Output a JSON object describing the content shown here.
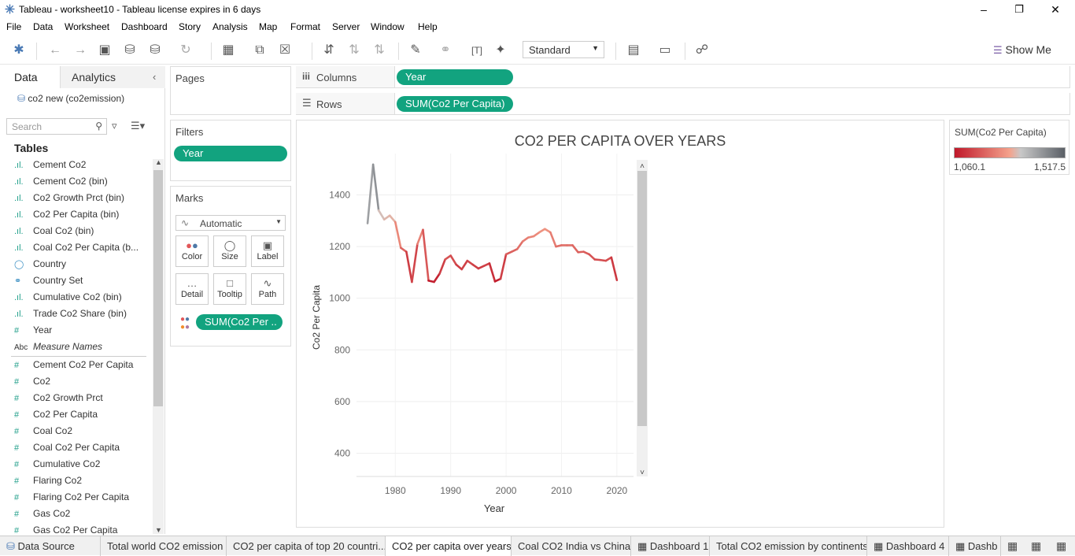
{
  "window": {
    "title": "Tableau - worksheet10 - Tableau license expires in 6 days"
  },
  "menu": [
    "File",
    "Data",
    "Worksheet",
    "Dashboard",
    "Story",
    "Analysis",
    "Map",
    "Format",
    "Server",
    "Window",
    "Help"
  ],
  "toolbar": {
    "fit_select": "Standard",
    "show_me": "Show Me"
  },
  "data_pane": {
    "tab_data": "Data",
    "tab_analytics": "Analytics",
    "datasource": "co2 new (co2emission)",
    "search_placeholder": "Search",
    "tables_title": "Tables",
    "dimensions": [
      {
        "icon": "bin-icon",
        "label": "Cement Co2"
      },
      {
        "icon": "bin-icon",
        "label": "Cement Co2 (bin)"
      },
      {
        "icon": "bin-icon",
        "label": "Co2 Growth Prct (bin)"
      },
      {
        "icon": "bin-icon",
        "label": "Co2 Per Capita (bin)"
      },
      {
        "icon": "bin-icon",
        "label": "Coal Co2 (bin)"
      },
      {
        "icon": "bin-icon",
        "label": "Coal Co2 Per Capita (b..."
      },
      {
        "icon": "globe-icon",
        "label": "Country"
      },
      {
        "icon": "set-icon",
        "label": "Country Set"
      },
      {
        "icon": "bin-icon",
        "label": "Cumulative Co2 (bin)"
      },
      {
        "icon": "bin-icon",
        "label": "Trade Co2 Share (bin)"
      },
      {
        "icon": "hash-icon",
        "label": "Year"
      },
      {
        "icon": "abc-icon",
        "label": "Measure Names"
      }
    ],
    "measures": [
      "Cement Co2 Per Capita",
      "Co2",
      "Co2 Growth Prct",
      "Co2 Per Capita",
      "Coal Co2",
      "Coal Co2 Per Capita",
      "Cumulative Co2",
      "Flaring Co2",
      "Flaring Co2 Per Capita",
      "Gas Co2",
      "Gas Co2 Per Capita"
    ]
  },
  "shelves": {
    "pages_title": "Pages",
    "filters_title": "Filters",
    "filter_pill": "Year",
    "marks_title": "Marks",
    "mark_type": "Automatic",
    "mark_buttons": [
      "Color",
      "Size",
      "Label",
      "Detail",
      "Tooltip",
      "Path"
    ],
    "marks_pill": "SUM(Co2 Per ..",
    "columns_label": "Columns",
    "columns_pill": "Year",
    "rows_label": "Rows",
    "rows_pill": "SUM(Co2 Per Capita)"
  },
  "legend": {
    "title": "SUM(Co2 Per Capita)",
    "min_label": "1,060.1",
    "max_label": "1,517.5",
    "min": 1060.1,
    "max": 1517.5,
    "color_low": "#c0182a",
    "color_mid": "#f4a28c",
    "color_high": "#5a5f66"
  },
  "chart_data": {
    "type": "line",
    "title": "CO2 PER CAPITA OVER YEARS",
    "xlabel": "Year",
    "ylabel": "Co2 Per Capita",
    "x_ticks": [
      1980,
      1990,
      2000,
      2010,
      2020
    ],
    "y_ticks": [
      400,
      600,
      800,
      1000,
      1200,
      1400
    ],
    "xlim": [
      1973,
      2023
    ],
    "ylim": [
      310,
      1560
    ],
    "grid": true,
    "x": [
      1975,
      1976,
      1977,
      1978,
      1979,
      1980,
      1981,
      1982,
      1983,
      1984,
      1985,
      1986,
      1987,
      1988,
      1989,
      1990,
      1991,
      1992,
      1993,
      1994,
      1995,
      1996,
      1997,
      1998,
      1999,
      2000,
      2001,
      2002,
      2003,
      2004,
      2005,
      2006,
      2007,
      2008,
      2009,
      2010,
      2011,
      2012,
      2013,
      2014,
      2015,
      2016,
      2017,
      2018,
      2019,
      2020
    ],
    "values": [
      1290,
      1517.5,
      1340,
      1305,
      1320,
      1295,
      1195,
      1180,
      1063,
      1210,
      1265,
      1068,
      1063,
      1095,
      1150,
      1165,
      1130,
      1112,
      1145,
      1130,
      1115,
      1125,
      1135,
      1065,
      1075,
      1170,
      1180,
      1190,
      1220,
      1235,
      1240,
      1255,
      1268,
      1255,
      1200,
      1205,
      1205,
      1205,
      1178,
      1180,
      1170,
      1150,
      1148,
      1145,
      1158,
      1070
    ]
  },
  "sheet_tabs": [
    {
      "label": "Data Source",
      "icon": "datasource-icon",
      "active": false
    },
    {
      "label": "Total world CO2 emission",
      "icon": "",
      "active": false
    },
    {
      "label": "CO2 per capita of top 20 countri...",
      "icon": "",
      "active": false
    },
    {
      "label": "CO2 per capita over years",
      "icon": "",
      "active": true
    },
    {
      "label": "Coal CO2 India vs China",
      "icon": "",
      "active": false
    },
    {
      "label": "Dashboard 1",
      "icon": "dashboard-icon",
      "active": false
    },
    {
      "label": "Total CO2 emission by continents",
      "icon": "",
      "active": false
    },
    {
      "label": "Dashboard 4",
      "icon": "dashboard-icon",
      "active": false
    },
    {
      "label": "Dashb",
      "icon": "dashboard-icon",
      "active": false
    }
  ]
}
